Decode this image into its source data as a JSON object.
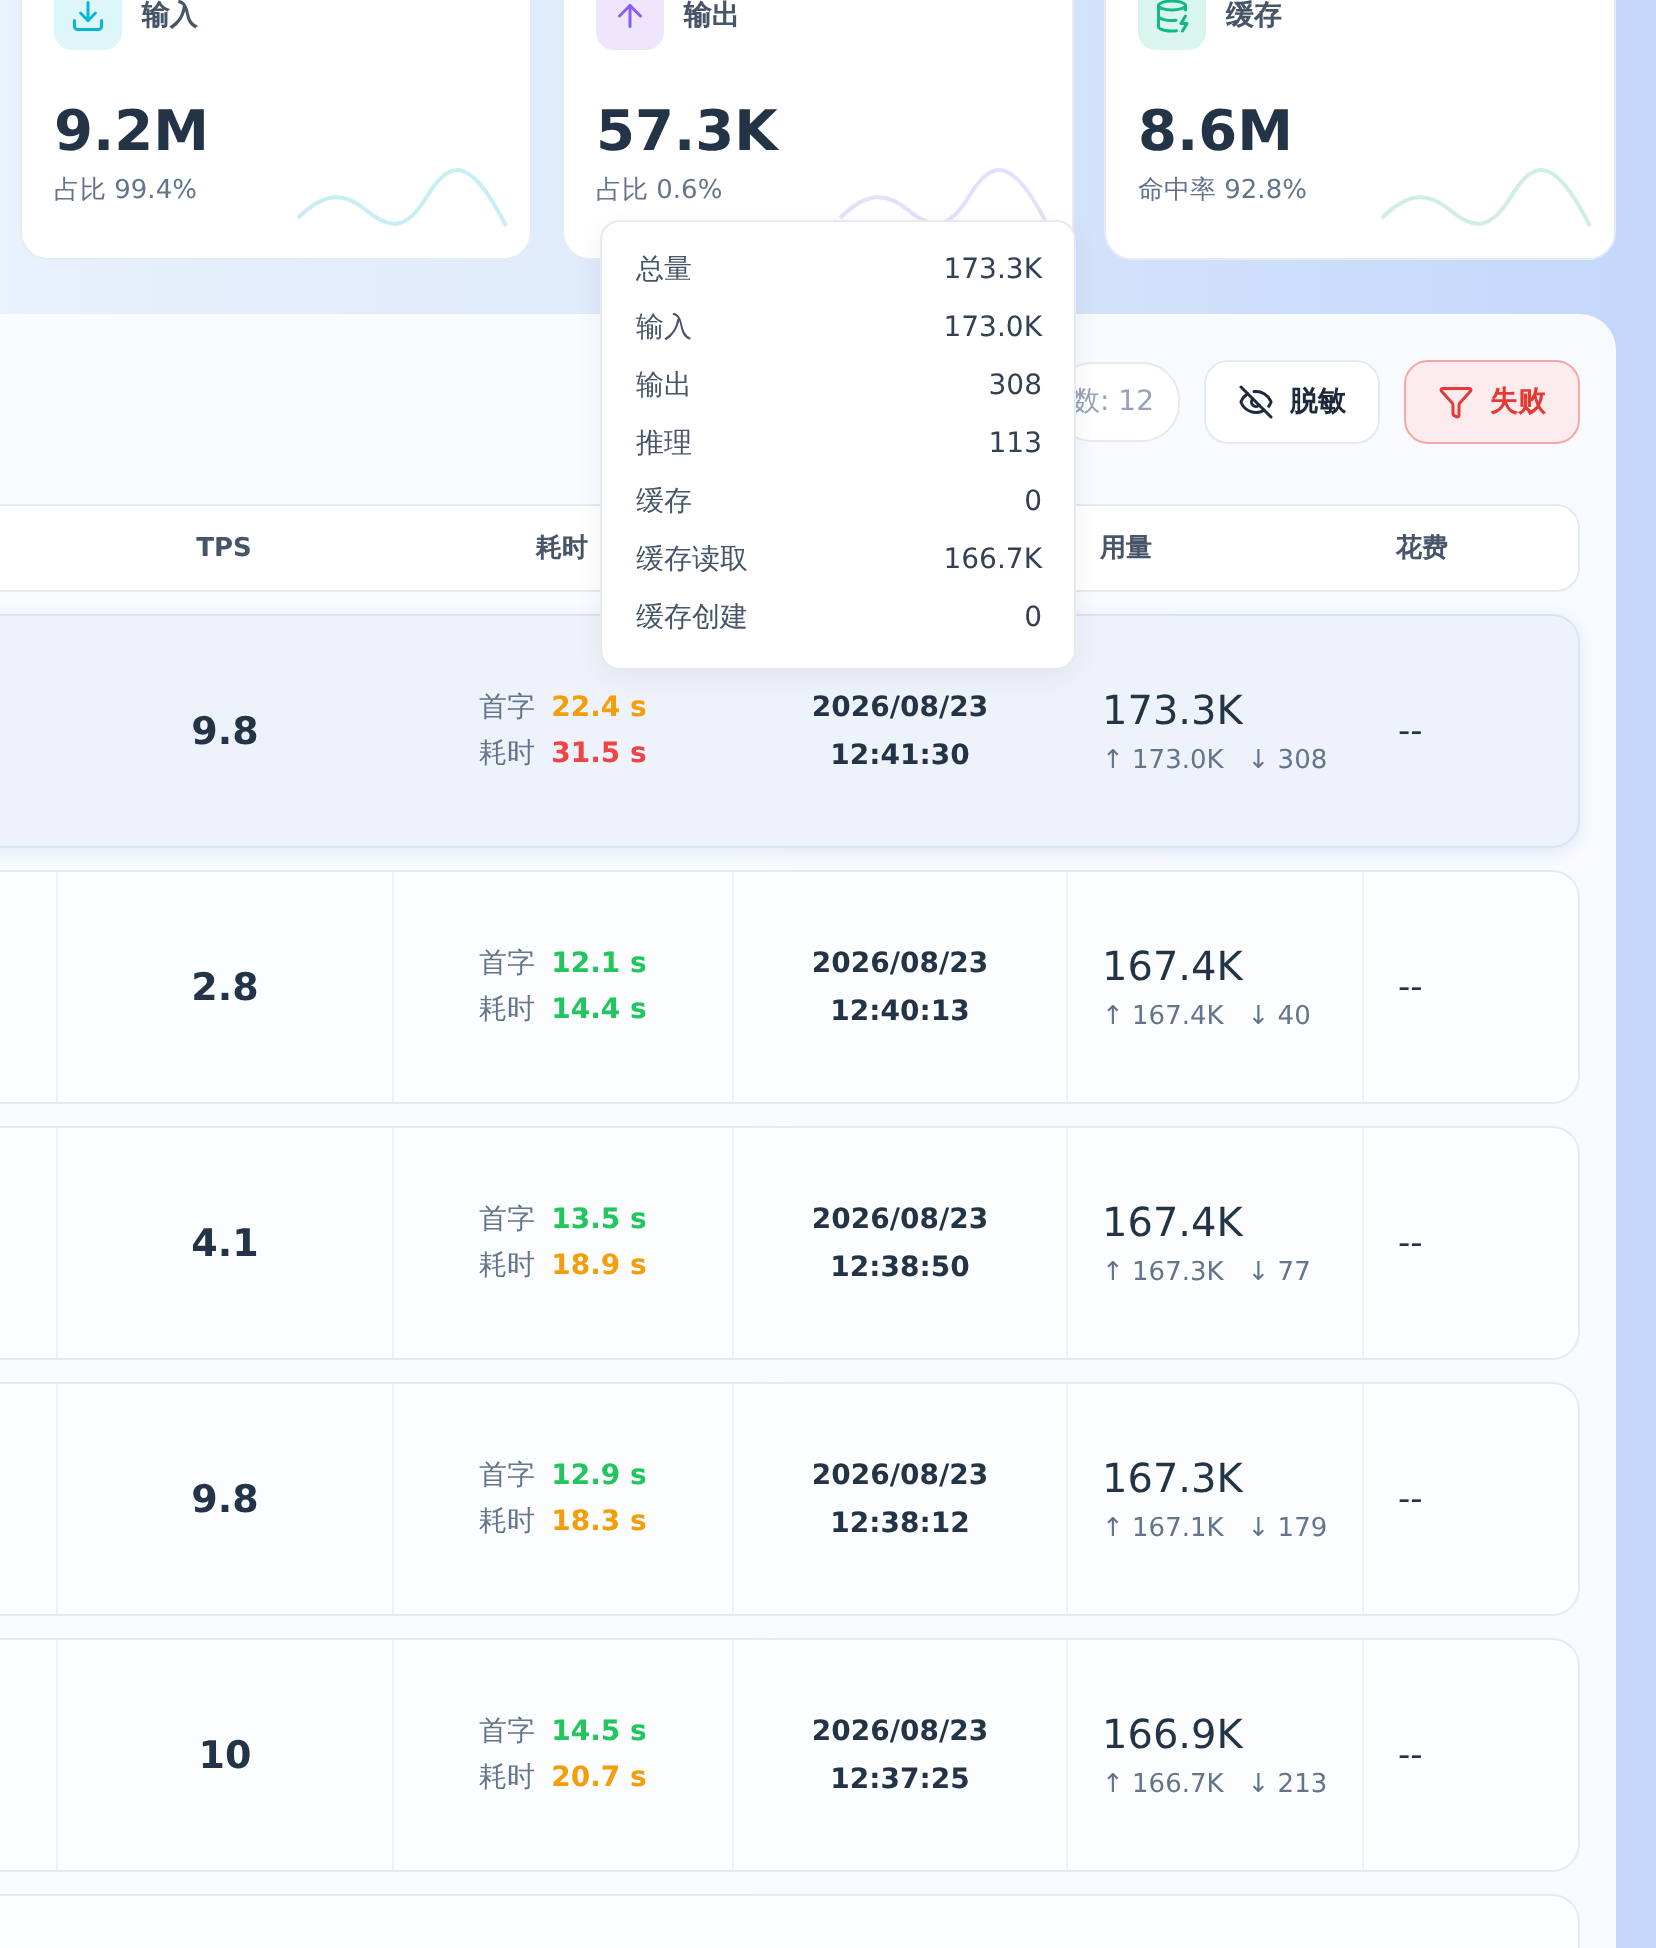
{
  "stat_cards": [
    {
      "kind": "input",
      "label": "输入",
      "value": "9.2M",
      "sub_label": "占比",
      "sub_value": "99.4%"
    },
    {
      "kind": "output",
      "label": "输出",
      "value": "57.3K",
      "sub_label": "占比",
      "sub_value": "0.6%"
    },
    {
      "kind": "cache",
      "label": "缓存",
      "value": "8.6M",
      "sub_label": "命中率",
      "sub_value": "92.8%"
    }
  ],
  "toolbar": {
    "count_chip": "数: 12",
    "buttons": [
      {
        "kind": "mask",
        "label": "脱敏",
        "selected": false
      },
      {
        "kind": "filter",
        "label": "失败",
        "selected": true
      }
    ]
  },
  "table": {
    "columns": [
      "TPS",
      "耗时",
      "用量",
      "花费"
    ],
    "rows": [
      {
        "selected": true,
        "tps": "9.8",
        "timings": [
          {
            "kind": "medium",
            "label": "首字",
            "value": "22.4 s"
          },
          {
            "kind": "slow",
            "label": "耗时",
            "value": "31.5 s"
          }
        ],
        "date": "2026/08/23",
        "time": "12:41:30",
        "usage": "173.3K",
        "usage_in": "↑ 173.0K",
        "usage_out": "↓ 308",
        "cost": "--"
      },
      {
        "selected": false,
        "tps": "2.8",
        "timings": [
          {
            "kind": "fast",
            "label": "首字",
            "value": "12.1 s"
          },
          {
            "kind": "fast",
            "label": "耗时",
            "value": "14.4 s"
          }
        ],
        "date": "2026/08/23",
        "time": "12:40:13",
        "usage": "167.4K",
        "usage_in": "↑ 167.4K",
        "usage_out": "↓ 40",
        "cost": "--"
      },
      {
        "selected": false,
        "tps": "4.1",
        "timings": [
          {
            "kind": "fast",
            "label": "首字",
            "value": "13.5 s"
          },
          {
            "kind": "medium",
            "label": "耗时",
            "value": "18.9 s"
          }
        ],
        "date": "2026/08/23",
        "time": "12:38:50",
        "usage": "167.4K",
        "usage_in": "↑ 167.3K",
        "usage_out": "↓ 77",
        "cost": "--"
      },
      {
        "selected": false,
        "tps": "9.8",
        "timings": [
          {
            "kind": "fast",
            "label": "首字",
            "value": "12.9 s"
          },
          {
            "kind": "medium",
            "label": "耗时",
            "value": "18.3 s"
          }
        ],
        "date": "2026/08/23",
        "time": "12:38:12",
        "usage": "167.3K",
        "usage_in": "↑ 167.1K",
        "usage_out": "↓ 179",
        "cost": "--"
      },
      {
        "selected": false,
        "tps": "10",
        "timings": [
          {
            "kind": "fast",
            "label": "首字",
            "value": "14.5 s"
          },
          {
            "kind": "medium",
            "label": "耗时",
            "value": "20.7 s"
          }
        ],
        "date": "2026/08/23",
        "time": "12:37:25",
        "usage": "166.9K",
        "usage_in": "↑ 166.7K",
        "usage_out": "↓ 213",
        "cost": "--"
      }
    ]
  },
  "tooltip": {
    "rows": [
      {
        "label": "总量",
        "value": "173.3K"
      },
      {
        "label": "输入",
        "value": "173.0K"
      },
      {
        "label": "输出",
        "value": "308"
      },
      {
        "label": "推理",
        "value": "113"
      },
      {
        "label": "缓存",
        "value": "0"
      },
      {
        "label": "缓存读取",
        "value": "166.7K"
      },
      {
        "label": "缓存创建",
        "value": "0"
      }
    ]
  }
}
